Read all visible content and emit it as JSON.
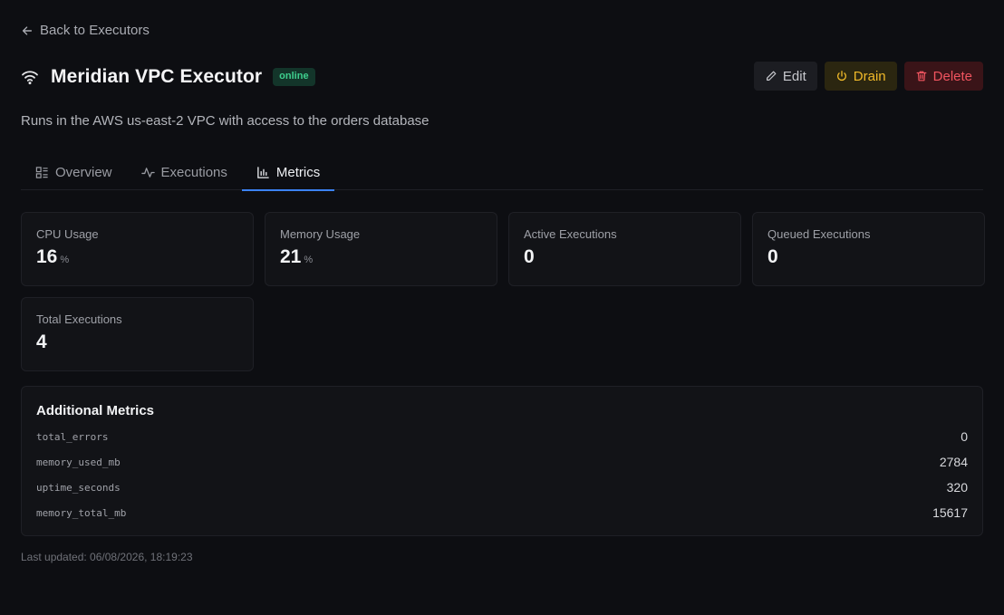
{
  "nav": {
    "back_label": "Back to Executors"
  },
  "header": {
    "title": "Meridian VPC Executor",
    "status": "online",
    "icon": "wifi-icon",
    "colors": {
      "status_fg": "#3ecf8e",
      "status_bg": "#13352a"
    }
  },
  "actions": {
    "edit": "Edit",
    "drain": "Drain",
    "delete": "Delete",
    "colors": {
      "drain": "#f0b929",
      "delete": "#f0545f"
    }
  },
  "description": "Runs in the AWS us-east-2 VPC with access to the orders database",
  "tabs": [
    {
      "label": "Overview",
      "icon": "overview-icon",
      "active": false
    },
    {
      "label": "Executions",
      "icon": "activity-icon",
      "active": false
    },
    {
      "label": "Metrics",
      "icon": "bar-chart-icon",
      "active": true
    }
  ],
  "accent": "#3b82f6",
  "cards": [
    {
      "label": "CPU Usage",
      "value": "16",
      "unit": "%"
    },
    {
      "label": "Memory Usage",
      "value": "21",
      "unit": "%"
    },
    {
      "label": "Active Executions",
      "value": "0",
      "unit": ""
    },
    {
      "label": "Queued Executions",
      "value": "0",
      "unit": ""
    },
    {
      "label": "Total Executions",
      "value": "4",
      "unit": ""
    }
  ],
  "additional_metrics": {
    "title": "Additional Metrics",
    "rows": [
      {
        "key": "total_errors",
        "value": "0"
      },
      {
        "key": "memory_used_mb",
        "value": "2784"
      },
      {
        "key": "uptime_seconds",
        "value": "320"
      },
      {
        "key": "memory_total_mb",
        "value": "15617"
      }
    ]
  },
  "footer": {
    "last_updated": "Last updated: 06/08/2026, 18:19:23"
  }
}
